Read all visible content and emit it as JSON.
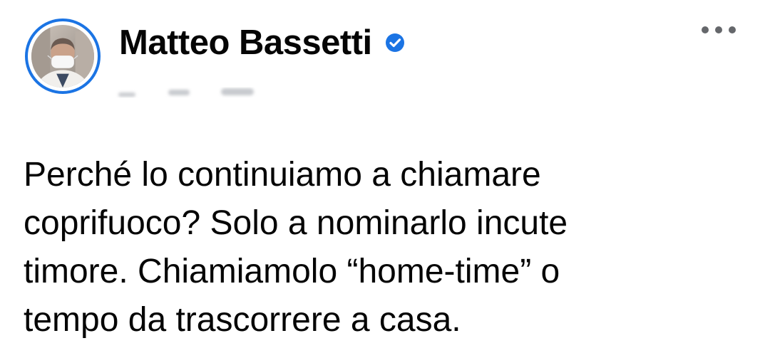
{
  "post": {
    "author_name": "Matteo Bassetti",
    "verified_icon": "verified-badge-icon",
    "more_icon": "more-options-icon",
    "text": "Perché lo continuiamo a chiamare\ncoprifuoco? Solo a nominarlo incute\ntimore. Chiamiamolo “home-time” o\ntempo da trascorrere a casa."
  },
  "colors": {
    "verified": "#1b74e4",
    "avatar_ring": "#1b74e4",
    "text": "#050505",
    "icon_gray": "#65676b"
  }
}
